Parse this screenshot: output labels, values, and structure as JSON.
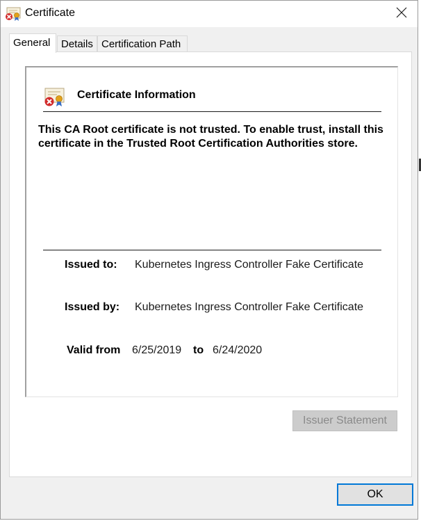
{
  "window": {
    "title": "Certificate",
    "icon": "certificate-error-icon",
    "close_icon": "close-icon"
  },
  "tabs": [
    {
      "label": "General",
      "active": true
    },
    {
      "label": "Details",
      "active": false
    },
    {
      "label": "Certification Path",
      "active": false
    }
  ],
  "info": {
    "heading": "Certificate Information",
    "icon": "certificate-error-icon",
    "message": "This CA Root certificate is not trusted. To enable trust, install this certificate in the Trusted Root Certification Authorities store."
  },
  "details": {
    "issued_to_label": "Issued to:",
    "issued_to_value": "Kubernetes Ingress Controller Fake Certificate",
    "issued_by_label": "Issued by:",
    "issued_by_value": "Kubernetes Ingress Controller Fake Certificate",
    "valid_from_label": "Valid from",
    "valid_from_value": "6/25/2019",
    "to_label": "to",
    "valid_to_value": "6/24/2020"
  },
  "buttons": {
    "issuer_statement": "Issuer Statement",
    "issuer_statement_enabled": false,
    "ok": "OK"
  },
  "colors": {
    "focus_border": "#0078d7",
    "disabled_text": "#8a8a8a",
    "dialog_background": "#f0f0f0"
  }
}
